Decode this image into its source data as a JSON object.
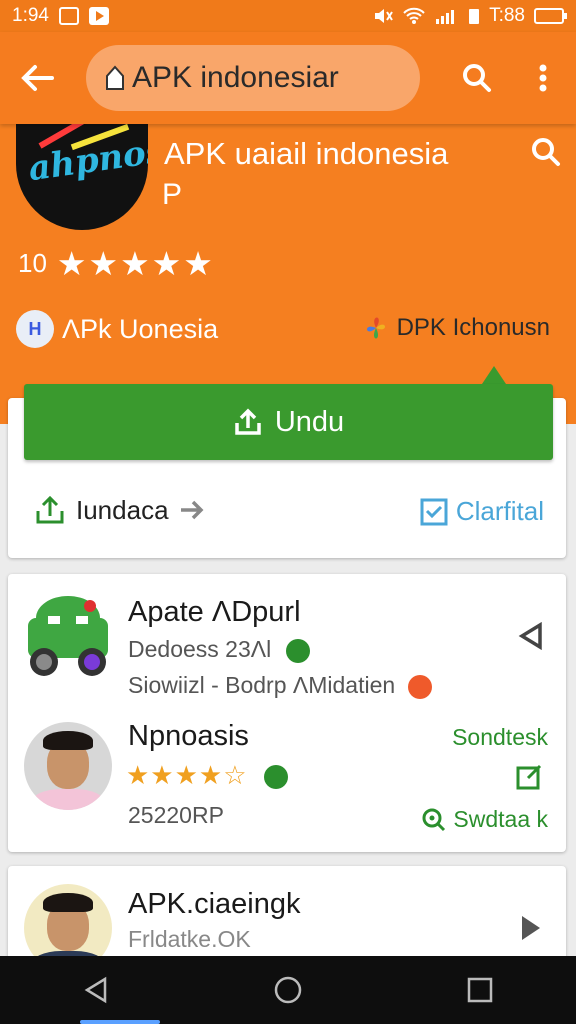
{
  "status_bar": {
    "time": "1:94",
    "battery_text": "T:88"
  },
  "header": {
    "search_text": "APK indonesiar",
    "colors": {
      "bar": "#f57c1f",
      "search_bg": "#f9a66a"
    }
  },
  "app": {
    "title": "APK uaiail indonesia",
    "subtitle": "P",
    "rating_count": "10",
    "stars": "★★★★★",
    "developer_left": "ΛPk Uonesia",
    "developer_left_avatar": "H",
    "developer_right": "DPK Ichonusn"
  },
  "actions": {
    "install_label": "Undu",
    "share_label": "Iundaca",
    "verify_label": "Clarfital",
    "colors": {
      "install": "#3a9a2e",
      "verify": "#4aa6d8"
    }
  },
  "list": {
    "items": [
      {
        "title": "Apate ΛDpurl",
        "line1": "Dedoess 23Λl",
        "line2": "Siowiizl - Bodrp ΛMidatien",
        "icon": "android-robot-icon"
      },
      {
        "title": "Npnoasis",
        "stars": "★★★★☆",
        "price": "25220RP",
        "link_top": "Sondtesk",
        "link_bottom": "Swdtaa k",
        "icon": "person-avatar"
      }
    ]
  },
  "bottom_item": {
    "title": "APK.ciaeingk",
    "subtitle": "Frldatke.OK"
  },
  "navbar": {
    "buttons": [
      "back-icon",
      "home-icon",
      "recents-icon"
    ]
  }
}
